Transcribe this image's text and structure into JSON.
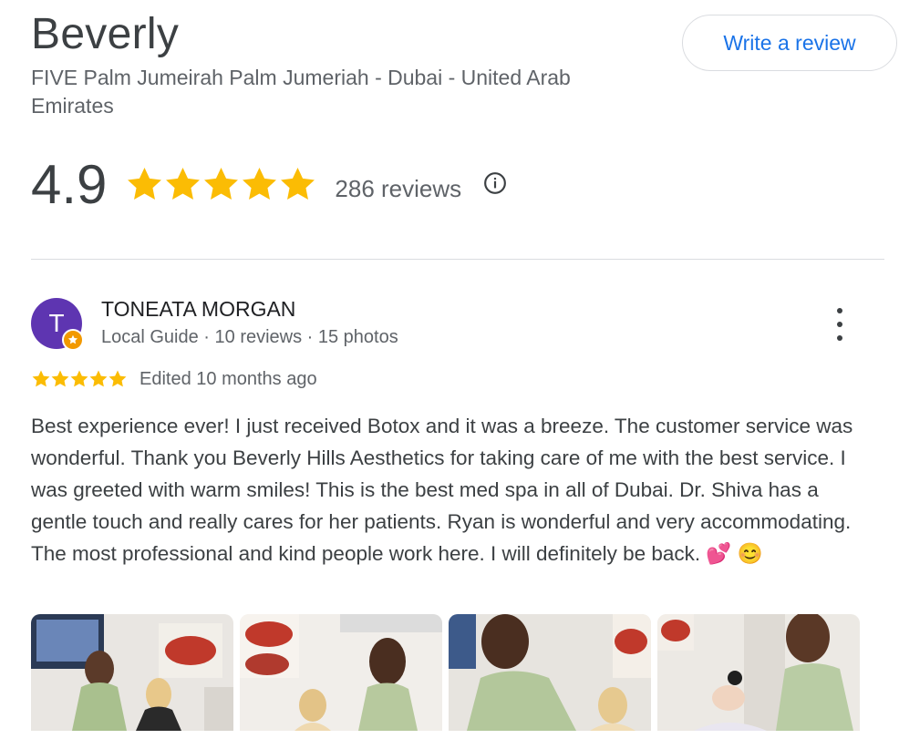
{
  "business": {
    "name": "Beverly",
    "address": "FIVE Palm Jumeirah Palm Jumeriah - Dubai - United Arab Emirates",
    "write_review_label": "Write a review"
  },
  "rating": {
    "value": "4.9",
    "stars": 5,
    "review_count": "286 reviews",
    "info_icon": "info-icon"
  },
  "review": {
    "avatar_letter": "T",
    "reviewer_name": "TONEATA MORGAN",
    "reviewer_meta": "Local Guide · 10 reviews · 15 photos",
    "stars": 5,
    "edited": "Edited 10 months ago",
    "text": "Best experience ever! I just received Botox and it was a breeze. The customer service was wonderful. Thank you Beverly Hills Aesthetics for taking care of me with the best service. I was greeted with warm smiles! This is the best med spa in all of Dubai. Dr. Shiva has a gentle touch and really cares for her patients. Ryan is wonderful and very accommodating. The most professional and kind people work here. I will definitely be back. 💕 😊",
    "photo_count": 4
  },
  "colors": {
    "star": "#fbbc04",
    "link_blue": "#1a73e8",
    "avatar_bg": "#5e35b1",
    "local_guide_badge": "#f29900"
  }
}
